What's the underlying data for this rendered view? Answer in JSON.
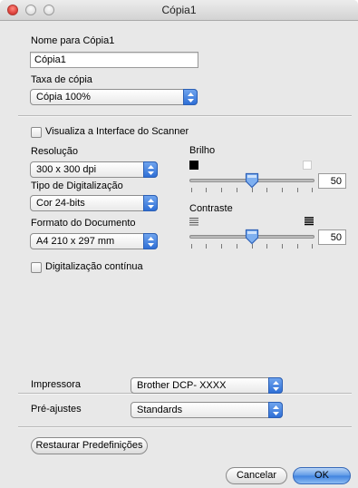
{
  "window": {
    "title": "Cópia1"
  },
  "name_field": {
    "label": "Nome para Cópia1",
    "value": "Cópia1"
  },
  "copy_rate": {
    "label": "Taxa de cópia",
    "value": "Cópia 100%"
  },
  "scanner_ui": {
    "label": "Visualiza a Interface do Scanner",
    "checked": false
  },
  "resolution": {
    "label": "Resolução",
    "value": "300 x 300 dpi"
  },
  "scan_type": {
    "label": "Tipo de Digitalização",
    "value": "Cor 24-bits"
  },
  "doc_format": {
    "label": "Formato do Documento",
    "value": "A4 210 x 297 mm"
  },
  "continuous": {
    "label": "Digitalização contínua",
    "checked": false
  },
  "brightness": {
    "label": "Brilho",
    "value": "50"
  },
  "contrast": {
    "label": "Contraste",
    "value": "50"
  },
  "printer": {
    "label": "Impressora",
    "value": "Brother DCP- XXXX"
  },
  "presets": {
    "label": "Pré-ajustes",
    "value": "Standards"
  },
  "buttons": {
    "restore": "Restaurar Predefinições",
    "cancel": "Cancelar",
    "ok": "OK"
  },
  "colors": {
    "accent": "#3f82df",
    "close": "#e0443e"
  }
}
